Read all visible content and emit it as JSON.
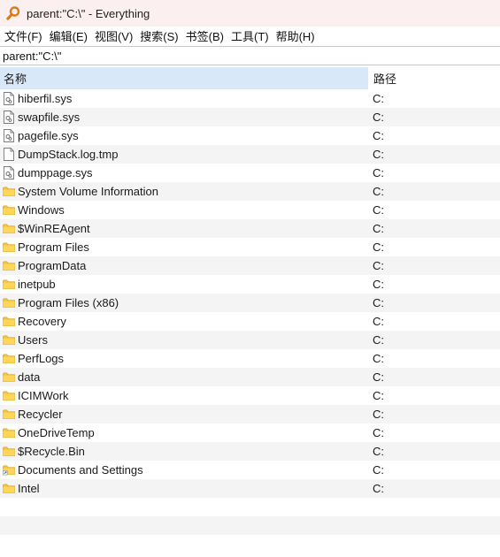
{
  "window": {
    "title": "parent:\"C:\\\"  - Everything"
  },
  "menu": [
    {
      "label": "文件(F)"
    },
    {
      "label": "编辑(E)"
    },
    {
      "label": "视图(V)"
    },
    {
      "label": "搜索(S)"
    },
    {
      "label": "书签(B)"
    },
    {
      "label": "工具(T)"
    },
    {
      "label": "帮助(H)"
    }
  ],
  "search": {
    "value": "parent:\"C:\\\""
  },
  "columns": {
    "name": "名称",
    "path": "路径"
  },
  "files": [
    {
      "name": "hiberfil.sys",
      "path": "C:",
      "icon": "system-file-icon"
    },
    {
      "name": "swapfile.sys",
      "path": "C:",
      "icon": "system-file-icon"
    },
    {
      "name": "pagefile.sys",
      "path": "C:",
      "icon": "system-file-icon"
    },
    {
      "name": "DumpStack.log.tmp",
      "path": "C:",
      "icon": "file-icon"
    },
    {
      "name": "dumppage.sys",
      "path": "C:",
      "icon": "system-file-icon"
    },
    {
      "name": "System Volume Information",
      "path": "C:",
      "icon": "folder-icon"
    },
    {
      "name": "Windows",
      "path": "C:",
      "icon": "folder-icon"
    },
    {
      "name": "$WinREAgent",
      "path": "C:",
      "icon": "folder-icon"
    },
    {
      "name": "Program Files",
      "path": "C:",
      "icon": "folder-icon"
    },
    {
      "name": "ProgramData",
      "path": "C:",
      "icon": "folder-icon"
    },
    {
      "name": "inetpub",
      "path": "C:",
      "icon": "folder-icon"
    },
    {
      "name": "Program Files (x86)",
      "path": "C:",
      "icon": "folder-icon"
    },
    {
      "name": "Recovery",
      "path": "C:",
      "icon": "folder-icon"
    },
    {
      "name": "Users",
      "path": "C:",
      "icon": "folder-icon"
    },
    {
      "name": "PerfLogs",
      "path": "C:",
      "icon": "folder-icon"
    },
    {
      "name": "data",
      "path": "C:",
      "icon": "folder-icon"
    },
    {
      "name": "ICIMWork",
      "path": "C:",
      "icon": "folder-icon"
    },
    {
      "name": "Recycler",
      "path": "C:",
      "icon": "folder-icon"
    },
    {
      "name": "OneDriveTemp",
      "path": "C:",
      "icon": "folder-icon"
    },
    {
      "name": "$Recycle.Bin",
      "path": "C:",
      "icon": "folder-icon"
    },
    {
      "name": "Documents and Settings",
      "path": "C:",
      "icon": "folder-shortcut-icon"
    },
    {
      "name": "Intel",
      "path": "C:",
      "icon": "folder-icon"
    }
  ]
}
